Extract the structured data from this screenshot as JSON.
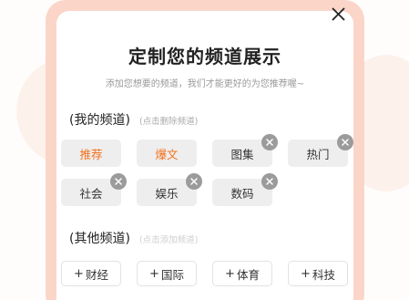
{
  "title": "定制您的频道展示",
  "subtitle": "添加您想要的频道，我们才能更好的为您推荐喔~",
  "my_channels": {
    "title": "(我的频道)",
    "hint": "(点击删除频道)",
    "items": [
      {
        "label": "推荐",
        "fixed": true
      },
      {
        "label": "爆文",
        "fixed": true
      },
      {
        "label": "图集",
        "fixed": false
      },
      {
        "label": "热门",
        "fixed": false
      },
      {
        "label": "社会",
        "fixed": false
      },
      {
        "label": "娱乐",
        "fixed": false
      },
      {
        "label": "数码",
        "fixed": false
      }
    ]
  },
  "other_channels": {
    "title": "(其他频道)",
    "hint": "(点击添加频道)",
    "add_prefix": "+",
    "items": [
      "财经",
      "国际",
      "体育",
      "科技"
    ]
  },
  "icons": {
    "close": "close-icon",
    "remove": "remove-badge-icon"
  },
  "colors": {
    "accent": "#f2711c",
    "frame": "#fbd5c8",
    "chip_bg": "#eeeeee",
    "badge": "#9b9b9b"
  }
}
